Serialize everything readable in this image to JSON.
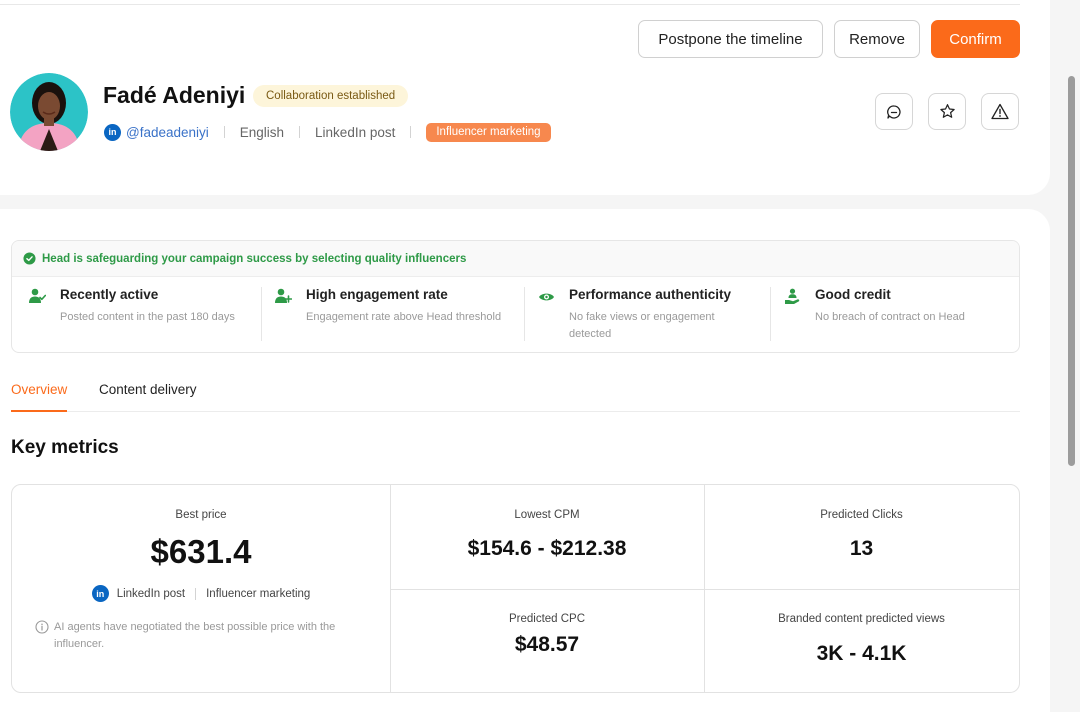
{
  "header": {
    "buttons": {
      "postpone": "Postpone the timeline",
      "remove": "Remove",
      "confirm": "Confirm"
    }
  },
  "profile": {
    "name": "Fadé Adeniyi",
    "status_badge": "Collaboration established",
    "handle": "@fadeadeniyi",
    "language": "English",
    "content_type": "LinkedIn post",
    "category_tag": "Influencer marketing",
    "linkedin_icon_text": "in"
  },
  "quality": {
    "headline": "Head is safeguarding your campaign success by selecting quality influencers",
    "features": [
      {
        "title": "Recently active",
        "subtitle": "Posted content in the past 180 days",
        "icon": "user-check-icon"
      },
      {
        "title": "High engagement rate",
        "subtitle": "Engagement rate above Head threshold",
        "icon": "user-plus-icon"
      },
      {
        "title": "Performance authenticity",
        "subtitle": "No fake views or engagement detected",
        "icon": "eye-icon"
      },
      {
        "title": "Good credit",
        "subtitle": "No breach of contract on Head",
        "icon": "hand-user-icon"
      }
    ]
  },
  "tabs": {
    "overview": "Overview",
    "content_delivery": "Content delivery"
  },
  "metrics": {
    "section_title": "Key metrics",
    "best_price_label": "Best price",
    "best_price_value": "$631.4",
    "best_price_platform": "LinkedIn post",
    "best_price_category": "Influencer marketing",
    "best_price_note": "AI agents have negotiated the best possible price with the influencer.",
    "lowest_cpm_label": "Lowest CPM",
    "lowest_cpm_value": "$154.6 - $212.38",
    "predicted_clicks_label": "Predicted Clicks",
    "predicted_clicks_value": "13",
    "predicted_cpc_label": "Predicted CPC",
    "predicted_cpc_value": "$48.57",
    "branded_views_label": "Branded content predicted views",
    "branded_views_value": "3K - 4.1K"
  },
  "colors": {
    "accent": "#fb6a1a",
    "success": "#2e9a47",
    "linkedin": "#0a66c2"
  }
}
